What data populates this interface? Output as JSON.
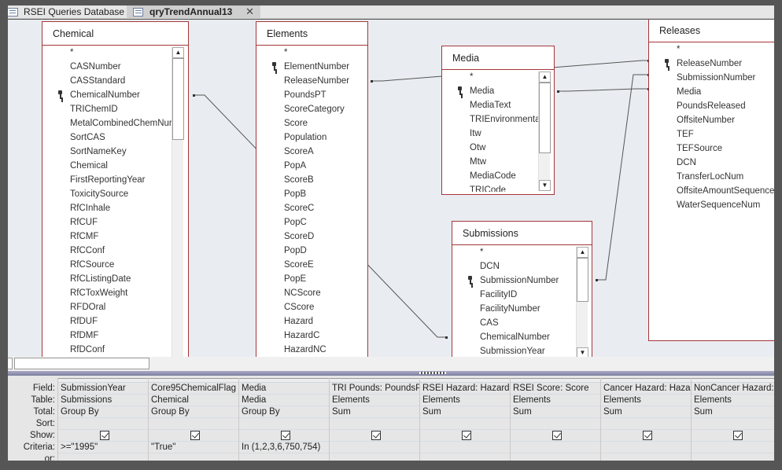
{
  "tabs": [
    {
      "label": "RSEI Queries Database",
      "icon": "database-icon",
      "active": false
    },
    {
      "label": "qryTrendAnnual13",
      "icon": "query-icon",
      "active": true,
      "close_icon": "close-icon"
    }
  ],
  "tables": {
    "chemical": {
      "title": "Chemical",
      "fields": [
        "*",
        "CASNumber",
        "CASStandard",
        "ChemicalNumber",
        "TRIChemID",
        "MetalCombinedChemNur",
        "SortCAS",
        "SortNameKey",
        "Chemical",
        "FirstReportingYear",
        "ToxicitySource",
        "RfCInhale",
        "RfCUF",
        "RfCMF",
        "RfCConf",
        "RfCSource",
        "RfCListingDate",
        "RfCToxWeight",
        "RFDOral",
        "RfDUF",
        "RfDMF",
        "RfDConf"
      ],
      "key_fields": [
        "ChemicalNumber"
      ]
    },
    "elements": {
      "title": "Elements",
      "fields": [
        "*",
        "ElementNumber",
        "ReleaseNumber",
        "PoundsPT",
        "ScoreCategory",
        "Score",
        "Population",
        "ScoreA",
        "PopA",
        "ScoreB",
        "PopB",
        "ScoreC",
        "PopC",
        "ScoreD",
        "PopD",
        "ScoreE",
        "PopE",
        "NCScore",
        "CScore",
        "Hazard",
        "HazardC",
        "HazardNC"
      ],
      "key_fields": [
        "ElementNumber"
      ]
    },
    "media": {
      "title": "Media",
      "fields": [
        "*",
        "Media",
        "MediaText",
        "TRIEnvironmenta",
        "Itw",
        "Otw",
        "Mtw",
        "MediaCode",
        "TRICode"
      ],
      "key_fields": [
        "Media"
      ]
    },
    "submissions": {
      "title": "Submissions",
      "fields": [
        "*",
        "DCN",
        "SubmissionNumber",
        "FacilityID",
        "FacilityNumber",
        "CAS",
        "ChemicalNumber",
        "SubmissionYear"
      ],
      "key_fields": [
        "SubmissionNumber"
      ]
    },
    "releases": {
      "title": "Releases",
      "fields": [
        "*",
        "ReleaseNumber",
        "SubmissionNumber",
        "Media",
        "PoundsReleased",
        "OffsiteNumber",
        "TEF",
        "TEFSource",
        "DCN",
        "TransferLocNum",
        "OffsiteAmountSequence",
        "WaterSequenceNum"
      ],
      "key_fields": [
        "ReleaseNumber"
      ]
    }
  },
  "joins": [
    {
      "from": "Chemical.ChemicalNumber",
      "to": "Submissions.ChemicalNumber"
    },
    {
      "from": "Elements.ReleaseNumber",
      "to": "Releases.ReleaseNumber"
    },
    {
      "from": "Media.Media",
      "to": "Releases.Media"
    },
    {
      "from": "Submissions.SubmissionNumber",
      "to": "Releases.SubmissionNumber"
    }
  ],
  "grid": {
    "row_labels": [
      "Field:",
      "Table:",
      "Total:",
      "Sort:",
      "Show:",
      "Criteria:",
      "or:"
    ],
    "columns": [
      {
        "field": "SubmissionYear",
        "table": "Submissions",
        "total": "Group By",
        "sort": "",
        "show": true,
        "criteria": ">=\"1995\""
      },
      {
        "field": "Core95ChemicalFlag",
        "table": "Chemical",
        "total": "Group By",
        "sort": "",
        "show": true,
        "criteria": "\"True\""
      },
      {
        "field": "Media",
        "table": "Media",
        "total": "Group By",
        "sort": "",
        "show": true,
        "criteria": "In (1,2,3,6,750,754)"
      },
      {
        "field": "TRI Pounds: PoundsPT",
        "table": "Elements",
        "total": "Sum",
        "sort": "",
        "show": true,
        "criteria": ""
      },
      {
        "field": "RSEI Hazard: Hazard",
        "table": "Elements",
        "total": "Sum",
        "sort": "",
        "show": true,
        "criteria": ""
      },
      {
        "field": "RSEI Score: Score",
        "table": "Elements",
        "total": "Sum",
        "sort": "",
        "show": true,
        "criteria": ""
      },
      {
        "field": "Cancer Hazard: HazardC",
        "table": "Elements",
        "total": "Sum",
        "sort": "",
        "show": true,
        "criteria": ""
      },
      {
        "field": "NonCancer Hazard: HazardNC",
        "table": "Elements",
        "total": "Sum",
        "sort": "",
        "show": true,
        "criteria": ""
      }
    ]
  },
  "colors": {
    "table_border": "#a4373a",
    "design_background": "#e9edf1",
    "frame": "#565656"
  }
}
